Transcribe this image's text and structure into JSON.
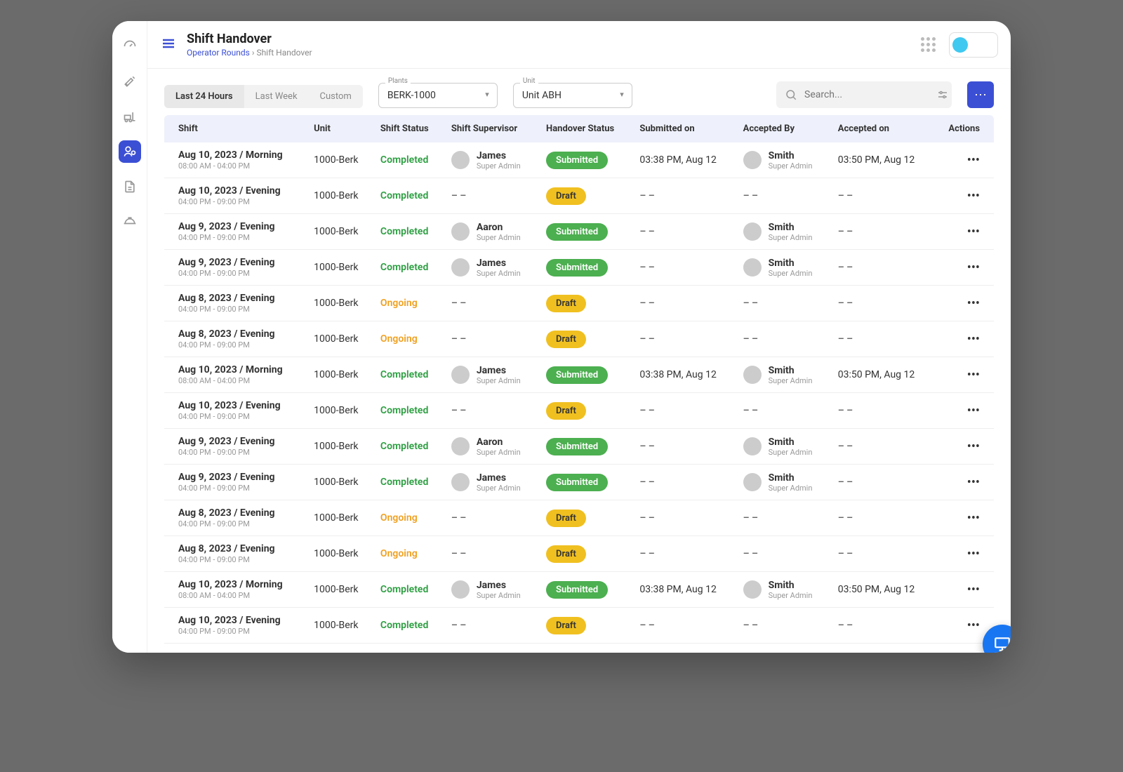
{
  "header": {
    "title": "Shift Handover",
    "breadcrumb_root": "Operator Rounds",
    "breadcrumb_sep": "›",
    "breadcrumb_leaf": "Shift Handover"
  },
  "controls": {
    "segments": [
      "Last 24 Hours",
      "Last Week",
      "Custom"
    ],
    "active_segment": 0,
    "plants_label": "Plants",
    "plants_value": "BERK-1000",
    "unit_label": "Unit",
    "unit_value": "Unit ABH",
    "search_placeholder": "Search...",
    "more_glyph": "⋯"
  },
  "table": {
    "headers": [
      "Shift",
      "Unit",
      "Shift Status",
      "Shift Supervisor",
      "Handover Status",
      "Submitted on",
      "Accepted By",
      "Accepted on",
      "Actions"
    ],
    "dash": "– –",
    "role_label": "Super Admin",
    "rows": [
      {
        "shift": "Aug 10, 2023 / Morning",
        "time": "08:00 AM - 04:00 PM",
        "unit": "1000-Berk",
        "shift_status": "Completed",
        "supervisor": "James",
        "handover": "Submitted",
        "submitted": "03:38 PM, Aug 12",
        "accepted_by": "Smith",
        "accepted_on": "03:50 PM, Aug 12"
      },
      {
        "shift": "Aug 10, 2023 / Evening",
        "time": "04:00 PM - 09:00 PM",
        "unit": "1000-Berk",
        "shift_status": "Completed",
        "supervisor": "",
        "handover": "Draft",
        "submitted": "",
        "accepted_by": "",
        "accepted_on": ""
      },
      {
        "shift": "Aug 9, 2023 / Evening",
        "time": "04:00 PM - 09:00 PM",
        "unit": "1000-Berk",
        "shift_status": "Completed",
        "supervisor": "Aaron",
        "handover": "Submitted",
        "submitted": "",
        "accepted_by": "Smith",
        "accepted_on": ""
      },
      {
        "shift": "Aug 9, 2023 / Evening",
        "time": "04:00 PM - 09:00 PM",
        "unit": "1000-Berk",
        "shift_status": "Completed",
        "supervisor": "James",
        "handover": "Submitted",
        "submitted": "",
        "accepted_by": "Smith",
        "accepted_on": ""
      },
      {
        "shift": "Aug 8, 2023 / Evening",
        "time": "04:00 PM - 09:00 PM",
        "unit": "1000-Berk",
        "shift_status": "Ongoing",
        "supervisor": "",
        "handover": "Draft",
        "submitted": "",
        "accepted_by": "",
        "accepted_on": ""
      },
      {
        "shift": "Aug 8, 2023 / Evening",
        "time": "04:00 PM - 09:00 PM",
        "unit": "1000-Berk",
        "shift_status": "Ongoing",
        "supervisor": "",
        "handover": "Draft",
        "submitted": "",
        "accepted_by": "",
        "accepted_on": ""
      },
      {
        "shift": "Aug 10, 2023 / Morning",
        "time": "08:00 AM - 04:00 PM",
        "unit": "1000-Berk",
        "shift_status": "Completed",
        "supervisor": "James",
        "handover": "Submitted",
        "submitted": "03:38 PM, Aug 12",
        "accepted_by": "Smith",
        "accepted_on": "03:50 PM, Aug 12"
      },
      {
        "shift": "Aug 10, 2023 / Evening",
        "time": "04:00 PM - 09:00 PM",
        "unit": "1000-Berk",
        "shift_status": "Completed",
        "supervisor": "",
        "handover": "Draft",
        "submitted": "",
        "accepted_by": "",
        "accepted_on": ""
      },
      {
        "shift": "Aug 9, 2023 / Evening",
        "time": "04:00 PM - 09:00 PM",
        "unit": "1000-Berk",
        "shift_status": "Completed",
        "supervisor": "Aaron",
        "handover": "Submitted",
        "submitted": "",
        "accepted_by": "Smith",
        "accepted_on": ""
      },
      {
        "shift": "Aug 9, 2023 / Evening",
        "time": "04:00 PM - 09:00 PM",
        "unit": "1000-Berk",
        "shift_status": "Completed",
        "supervisor": "James",
        "handover": "Submitted",
        "submitted": "",
        "accepted_by": "Smith",
        "accepted_on": ""
      },
      {
        "shift": "Aug 8, 2023 / Evening",
        "time": "04:00 PM - 09:00 PM",
        "unit": "1000-Berk",
        "shift_status": "Ongoing",
        "supervisor": "",
        "handover": "Draft",
        "submitted": "",
        "accepted_by": "",
        "accepted_on": ""
      },
      {
        "shift": "Aug 8, 2023 / Evening",
        "time": "04:00 PM - 09:00 PM",
        "unit": "1000-Berk",
        "shift_status": "Ongoing",
        "supervisor": "",
        "handover": "Draft",
        "submitted": "",
        "accepted_by": "",
        "accepted_on": ""
      },
      {
        "shift": "Aug 10, 2023 / Morning",
        "time": "08:00 AM - 04:00 PM",
        "unit": "1000-Berk",
        "shift_status": "Completed",
        "supervisor": "James",
        "handover": "Submitted",
        "submitted": "03:38 PM, Aug 12",
        "accepted_by": "Smith",
        "accepted_on": "03:50 PM, Aug 12"
      },
      {
        "shift": "Aug 10, 2023 / Evening",
        "time": "04:00 PM - 09:00 PM",
        "unit": "1000-Berk",
        "shift_status": "Completed",
        "supervisor": "",
        "handover": "Draft",
        "submitted": "",
        "accepted_by": "",
        "accepted_on": ""
      }
    ]
  },
  "sidebar_icons": [
    "dashboard",
    "tools",
    "forklift",
    "operator",
    "document",
    "hardhat"
  ]
}
